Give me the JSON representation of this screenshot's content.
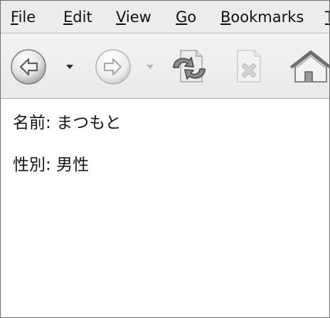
{
  "menubar": {
    "items": [
      {
        "key": "F",
        "rest": "ile"
      },
      {
        "key": "E",
        "rest": "dit"
      },
      {
        "key": "V",
        "rest": "iew"
      },
      {
        "key": "G",
        "rest": "o"
      },
      {
        "key": "B",
        "rest": "ookmarks"
      },
      {
        "key": "T",
        "rest": ""
      }
    ]
  },
  "toolbar": {
    "buttons": [
      {
        "icon": "back-arrow-icon",
        "enabled": true
      },
      {
        "icon": "dropdown-triangle-icon",
        "enabled": true
      },
      {
        "icon": "forward-arrow-icon",
        "enabled": false
      },
      {
        "icon": "dropdown-triangle-icon",
        "enabled": false
      },
      {
        "icon": "reload-icon",
        "enabled": true
      },
      {
        "icon": "stop-icon",
        "enabled": false
      },
      {
        "icon": "home-icon",
        "enabled": true
      }
    ]
  },
  "page": {
    "name": {
      "label": "名前",
      "separator": ": ",
      "value": "まつもと"
    },
    "gender": {
      "label": "性別",
      "separator": ": ",
      "value": "男性"
    }
  },
  "colors": {
    "menubar_bg": "#ececec",
    "toolbar_bg": "#eeeeee",
    "content_bg": "#ffffff",
    "text": "#111111"
  }
}
